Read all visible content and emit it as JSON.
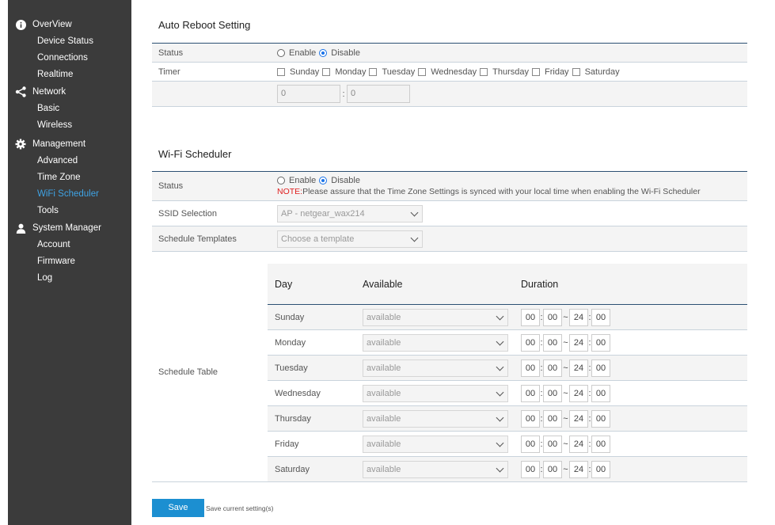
{
  "sidebar": {
    "groups": [
      {
        "label": "OverView",
        "icon": "info-icon",
        "items": [
          "Device Status",
          "Connections",
          "Realtime"
        ]
      },
      {
        "label": "Network",
        "icon": "share-icon",
        "items": [
          "Basic",
          "Wireless"
        ]
      },
      {
        "label": "Management",
        "icon": "gear-icon",
        "items": [
          "Advanced",
          "Time Zone",
          "WiFi Scheduler",
          "Tools"
        ]
      },
      {
        "label": "System Manager",
        "icon": "user-icon",
        "items": [
          "Account",
          "Firmware",
          "Log"
        ]
      }
    ],
    "active_item": "WiFi Scheduler",
    "active_color": "#3fa3e4"
  },
  "auto_reboot": {
    "title": "Auto Reboot Setting",
    "status_label": "Status",
    "enable_label": "Enable",
    "disable_label": "Disable",
    "status_value": "Disable",
    "timer_label": "Timer",
    "days": [
      "Sunday",
      "Monday",
      "Tuesday",
      "Wednesday",
      "Thursday",
      "Friday",
      "Saturday"
    ],
    "hour_value": "0",
    "minute_value": "0",
    "time_sep": ":"
  },
  "wifi_scheduler": {
    "title": "Wi-Fi Scheduler",
    "status_label": "Status",
    "enable_label": "Enable",
    "disable_label": "Disable",
    "status_value": "Disable",
    "note_prefix": "NOTE:",
    "note_text": "Please assure that the Time Zone Settings is synced with your local time when enabling the Wi-Fi Scheduler",
    "ssid_label": "SSID Selection",
    "ssid_value": "AP - netgear_wax214",
    "templates_label": "Schedule Templates",
    "templates_placeholder": "Choose a template",
    "table_label": "Schedule Table",
    "table_headers": {
      "day": "Day",
      "available": "Available",
      "duration": "Duration"
    },
    "rows": [
      {
        "day": "Sunday",
        "available": "available",
        "start_h": "00",
        "start_m": "00",
        "end_h": "24",
        "end_m": "00"
      },
      {
        "day": "Monday",
        "available": "available",
        "start_h": "00",
        "start_m": "00",
        "end_h": "24",
        "end_m": "00"
      },
      {
        "day": "Tuesday",
        "available": "available",
        "start_h": "00",
        "start_m": "00",
        "end_h": "24",
        "end_m": "00"
      },
      {
        "day": "Wednesday",
        "available": "available",
        "start_h": "00",
        "start_m": "00",
        "end_h": "24",
        "end_m": "00"
      },
      {
        "day": "Thursday",
        "available": "available",
        "start_h": "00",
        "start_m": "00",
        "end_h": "24",
        "end_m": "00"
      },
      {
        "day": "Friday",
        "available": "available",
        "start_h": "00",
        "start_m": "00",
        "end_h": "24",
        "end_m": "00"
      },
      {
        "day": "Saturday",
        "available": "available",
        "start_h": "00",
        "start_m": "00",
        "end_h": "24",
        "end_m": "00"
      }
    ],
    "colon": ":",
    "tilde": "~"
  },
  "footer": {
    "save_label": "Save",
    "save_note": "Save current setting(s)"
  },
  "colors": {
    "accent": "#1c8fd1",
    "sidebar_bg": "#3b3b3b",
    "divider": "#2b4f72",
    "note": "#e02020"
  }
}
